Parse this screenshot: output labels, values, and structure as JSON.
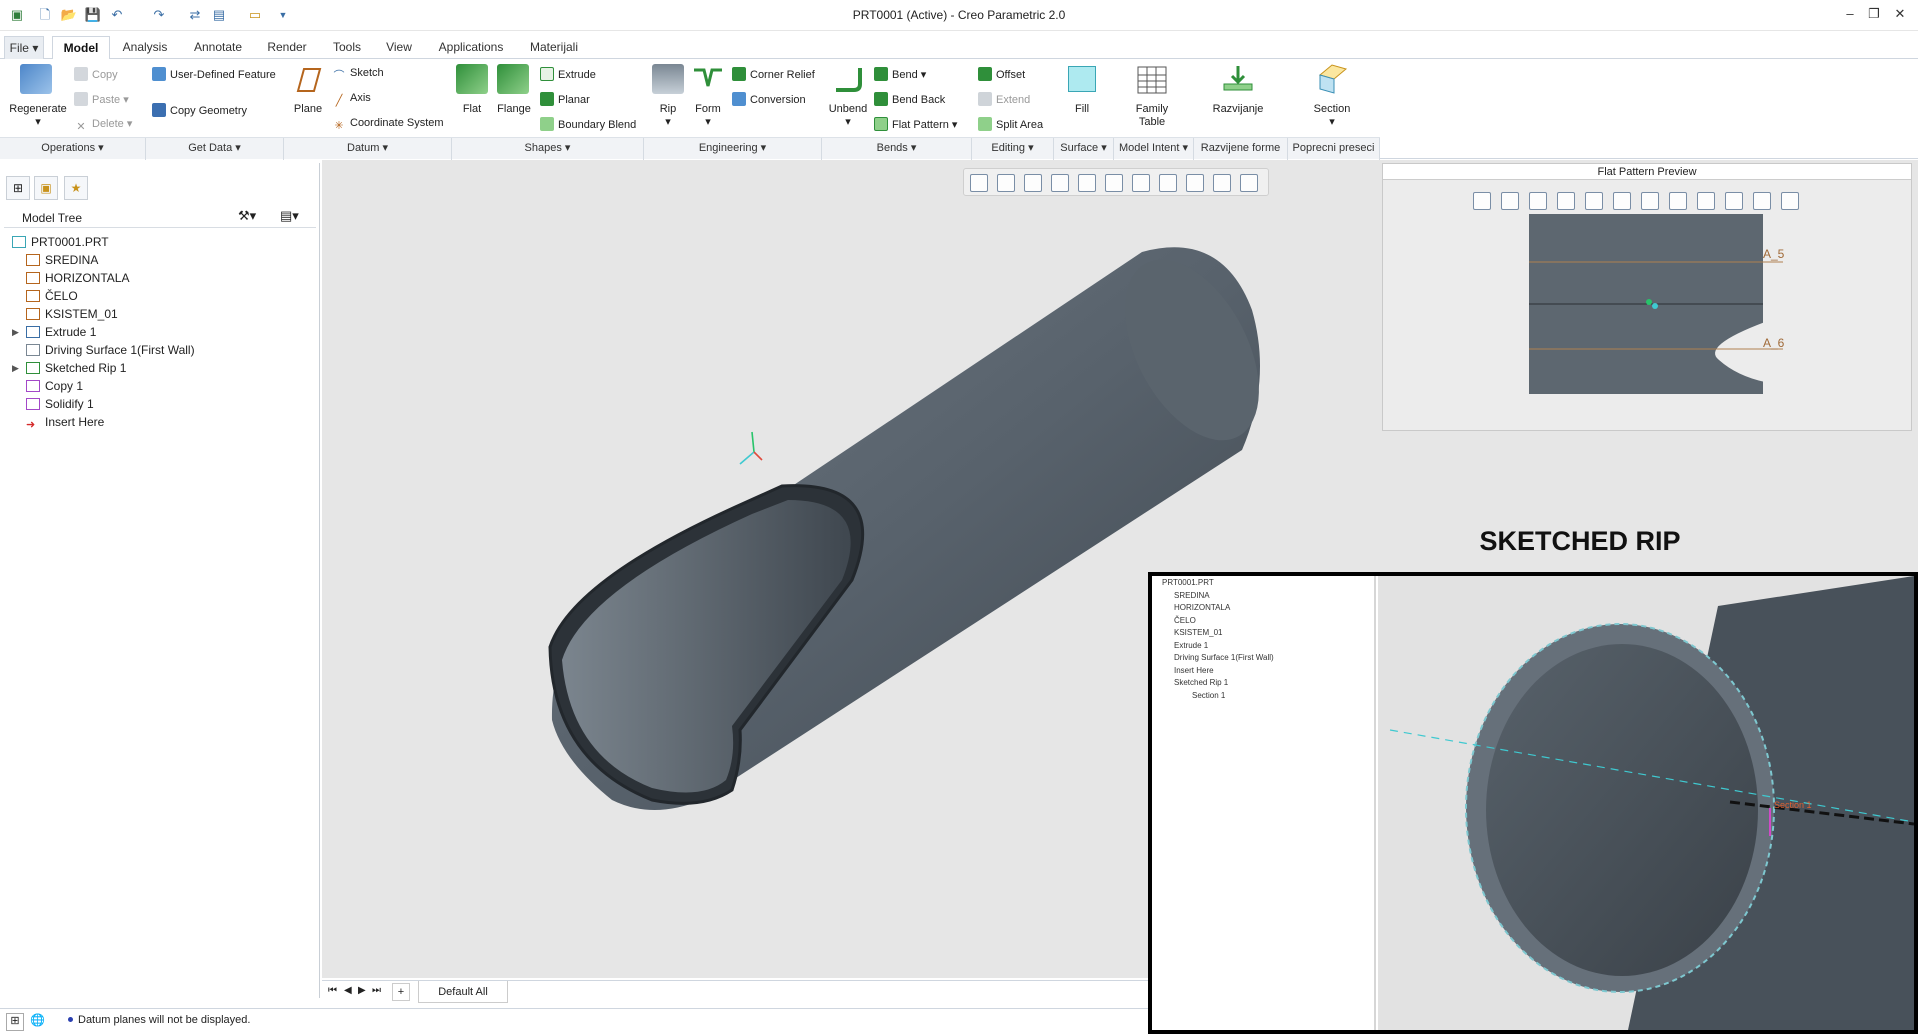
{
  "window": {
    "title": "PRT0001 (Active) - Creo Parametric 2.0",
    "minimize_icon": "minimize-icon",
    "restore_icon": "restore-icon",
    "close_icon": "close-icon"
  },
  "tabs": [
    "File",
    "Model",
    "Analysis",
    "Annotate",
    "Render",
    "Tools",
    "View",
    "Applications",
    "Materijali"
  ],
  "active_tab": "Model",
  "ribbon": {
    "operations": {
      "regenerate": "Regenerate",
      "copy": "Copy",
      "paste": "Paste",
      "delete": "Delete"
    },
    "get_data": {
      "udf": "User-Defined Feature",
      "copy_geometry": "Copy Geometry"
    },
    "datum": {
      "plane": "Plane",
      "sketch": "Sketch",
      "axis": "Axis",
      "csys": "Coordinate System"
    },
    "shapes": {
      "flat": "Flat",
      "flange": "Flange",
      "extrude": "Extrude",
      "planar": "Planar",
      "boundary_blend": "Boundary Blend"
    },
    "engineering": {
      "rip": "Rip",
      "form": "Form",
      "corner_relief": "Corner Relief",
      "conversion": "Conversion"
    },
    "bends": {
      "unbend": "Unbend",
      "bend": "Bend",
      "bend_back": "Bend Back",
      "flat_pattern": "Flat Pattern"
    },
    "editing": {
      "offset": "Offset",
      "extend": "Extend",
      "split_area": "Split Area"
    },
    "surface": {
      "fill": "Fill"
    },
    "model_intent": {
      "family_table": "Family Table"
    },
    "razvijene": {
      "razvijanje": "Razvijanje"
    },
    "poprecni": {
      "section": "Section"
    }
  },
  "groups": [
    "Operations",
    "Get Data",
    "Datum",
    "Shapes",
    "Engineering",
    "Bends",
    "Editing",
    "Surface",
    "Model Intent",
    "Razvijene forme",
    "Poprecni preseci"
  ],
  "model_tree": {
    "title": "Model Tree",
    "items": [
      {
        "label": "PRT0001.PRT",
        "icon": "part-icon"
      },
      {
        "label": "SREDINA",
        "icon": "datum-plane-icon"
      },
      {
        "label": "HORIZONTALA",
        "icon": "datum-plane-icon"
      },
      {
        "label": "ČELO",
        "icon": "datum-plane-icon"
      },
      {
        "label": "KSISTEM_01",
        "icon": "csys-icon"
      },
      {
        "label": "Extrude 1",
        "icon": "extrude-icon"
      },
      {
        "label": "Driving Surface 1(First Wall)",
        "icon": "surface-icon"
      },
      {
        "label": "Sketched Rip 1",
        "icon": "rip-icon"
      },
      {
        "label": "Copy 1",
        "icon": "copy-icon"
      },
      {
        "label": "Solidify 1",
        "icon": "solidify-icon"
      },
      {
        "label": "Insert Here",
        "icon": "insert-arrow-icon"
      }
    ]
  },
  "flat_pattern_preview": {
    "title": "Flat Pattern Preview",
    "labels": [
      "A_5",
      "A_6"
    ]
  },
  "inset": {
    "caption": "SKETCHED RIP",
    "tree": [
      "PRT0001.PRT",
      "SREDINA",
      "HORIZONTALA",
      "ČELO",
      "KSISTEM_01",
      "Extrude 1",
      "Driving Surface 1(First Wall)",
      "Insert Here",
      "Sketched Rip 1",
      "Section 1"
    ],
    "view_label": "Section 1"
  },
  "bottom": {
    "view_name": "Default All"
  },
  "status": {
    "message": "Datum planes will not be displayed."
  },
  "colors": {
    "accent": "#3a6ea5",
    "model": "#5c6670",
    "viewport": "#e6e6e6"
  }
}
